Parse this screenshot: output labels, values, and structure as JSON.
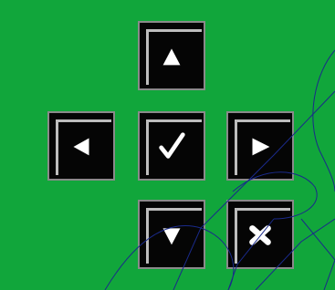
{
  "colors": {
    "background": "#11a63b",
    "key_fill": "#050505",
    "key_border": "#8a8a8a",
    "key_bevel": "#bdbdbd",
    "glyph": "#ffffff",
    "overlay_line": "#1a2a8a"
  },
  "keypad": {
    "keys": [
      {
        "id": "up",
        "icon": "triangle-up-icon"
      },
      {
        "id": "left",
        "icon": "triangle-left-icon"
      },
      {
        "id": "ok",
        "icon": "checkmark-icon"
      },
      {
        "id": "right",
        "icon": "triangle-right-icon"
      },
      {
        "id": "down",
        "icon": "triangle-down-icon"
      },
      {
        "id": "cancel",
        "icon": "cross-icon"
      }
    ]
  }
}
